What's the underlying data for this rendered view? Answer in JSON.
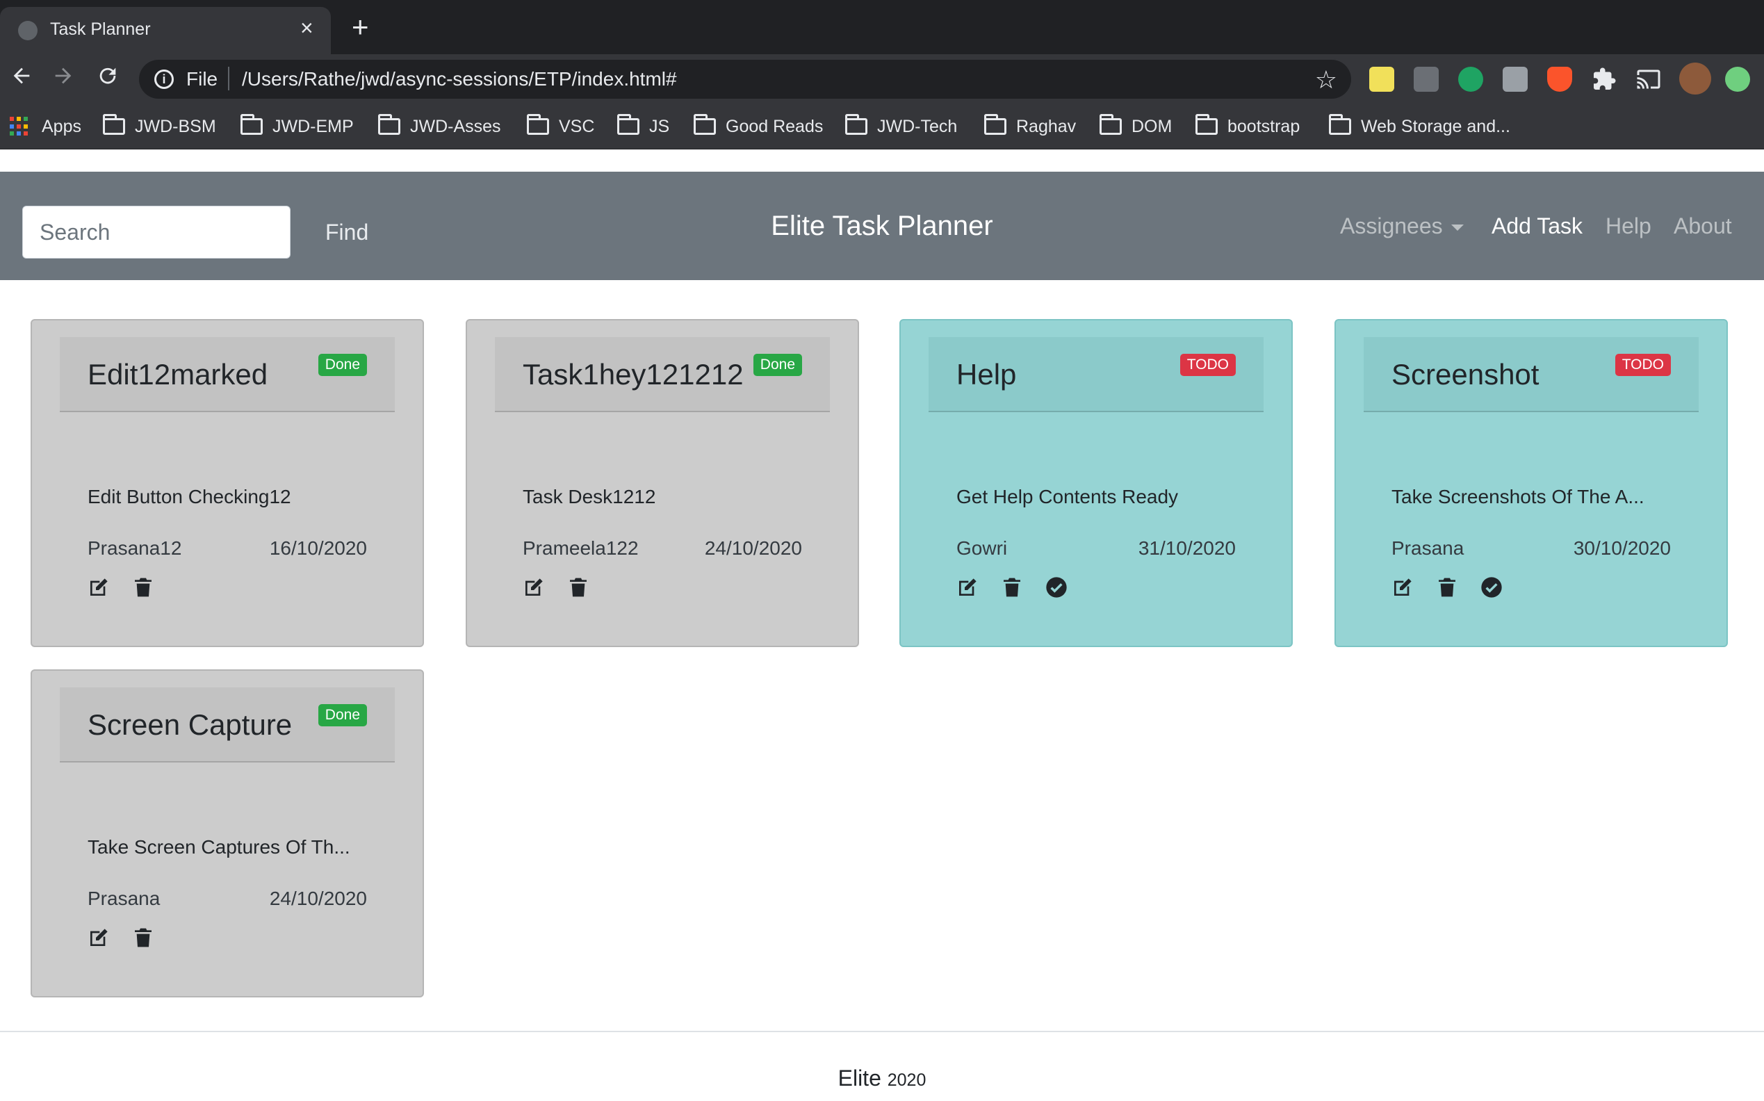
{
  "browser": {
    "tab_title": "Task Planner",
    "tab_close": "×",
    "new_tab": "+",
    "url_scheme": "File",
    "url": "/Users/Rathe/jwd/async-sessions/ETP/index.html#",
    "bookmarks": [
      {
        "label": "Apps",
        "icon": "apps-grid-icon"
      },
      {
        "label": "JWD-BSM",
        "icon": "folder-icon"
      },
      {
        "label": "JWD-EMP",
        "icon": "folder-icon"
      },
      {
        "label": "JWD-Asses",
        "icon": "folder-icon"
      },
      {
        "label": "VSC",
        "icon": "folder-icon"
      },
      {
        "label": "JS",
        "icon": "folder-icon"
      },
      {
        "label": "Good Reads",
        "icon": "folder-icon"
      },
      {
        "label": "JWD-Tech",
        "icon": "folder-icon"
      },
      {
        "label": "Raghav",
        "icon": "folder-icon"
      },
      {
        "label": "DOM",
        "icon": "folder-icon"
      },
      {
        "label": "bootstrap",
        "icon": "folder-icon"
      },
      {
        "label": "Web Storage and..."
      }
    ]
  },
  "navbar": {
    "search_placeholder": "Search",
    "find_label": "Find",
    "brand": "Elite Task Planner",
    "links": {
      "assignees": "Assignees",
      "add_task": "Add Task",
      "help": "Help",
      "about": "About"
    },
    "color": "#6c757d"
  },
  "tasks": [
    {
      "title": "Edit12marked",
      "status": "Done",
      "description": "Edit Button Checking12",
      "assignee": "Prasana12",
      "date": "16/10/2020"
    },
    {
      "title": "Task1hey121212",
      "status": "Done",
      "description": "Task Desk1212",
      "assignee": "Prameela122",
      "date": "24/10/2020"
    },
    {
      "title": "Help",
      "status": "TODO",
      "description": "Get Help Contents Ready",
      "assignee": "Gowri",
      "date": "31/10/2020"
    },
    {
      "title": "Screenshot",
      "status": "TODO",
      "description": "Take Screenshots Of The A...",
      "assignee": "Prasana",
      "date": "30/10/2020"
    },
    {
      "title": "Screen Capture",
      "status": "Done",
      "description": "Take Screen Captures Of Th...",
      "assignee": "Prasana",
      "date": "24/10/2020"
    }
  ],
  "colors": {
    "done_card": "#cccccc",
    "todo_card": "#96d4d4",
    "done_badge": "#28a745",
    "todo_badge": "#dc3545"
  },
  "footer": {
    "brand": "Elite",
    "year": "2020"
  }
}
